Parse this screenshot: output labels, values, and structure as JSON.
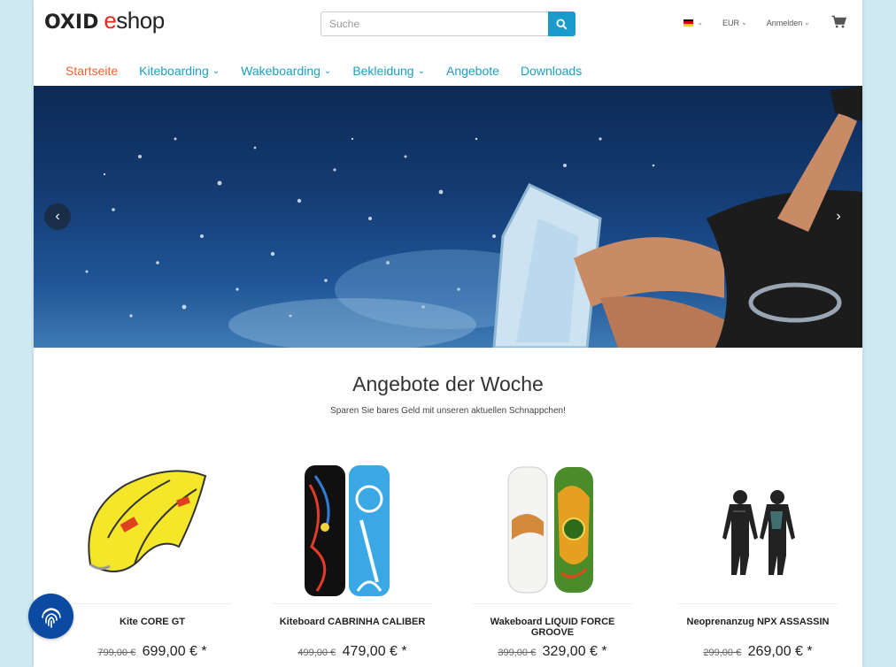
{
  "header": {
    "logo_text_1": "OXID",
    "logo_text_2": "shop",
    "logo_e": "e",
    "search_placeholder": "Suche",
    "language_flag": "de-flag",
    "currency": "EUR",
    "login": "Anmelden",
    "cart_icon": "cart-icon"
  },
  "nav": {
    "items": [
      {
        "label": "Startseite",
        "active": true
      },
      {
        "label": "Kiteboarding",
        "dropdown": true
      },
      {
        "label": "Wakeboarding",
        "dropdown": true
      },
      {
        "label": "Bekleidung",
        "dropdown": true
      },
      {
        "label": "Angebote"
      },
      {
        "label": "Downloads"
      }
    ]
  },
  "hero": {
    "prev_icon": "chevron-left-icon",
    "next_icon": "chevron-right-icon"
  },
  "section": {
    "title": "Angebote der Woche",
    "subtitle": "Sparen Sie bares Geld mit unseren aktuellen Schnappchen!"
  },
  "products": [
    {
      "name": "Kite CORE GT",
      "old_price": "799,00 €",
      "price": "699,00 € *"
    },
    {
      "name": "Kiteboard CABRINHA CALIBER",
      "old_price": "499,00 €",
      "price": "479,00 € *"
    },
    {
      "name": "Wakeboard LIQUID FORCE GROOVE",
      "old_price": "399,00 €",
      "price": "329,00 € *"
    },
    {
      "name": "Neoprenanzug NPX ASSASSIN",
      "old_price": "299,00 €",
      "price": "269,00 € *"
    }
  ],
  "colors": {
    "accent": "#1aa0c4",
    "active_nav": "#ef6430",
    "logo_red": "#e6261f",
    "search_button": "#1a9bc9",
    "background": "#cfe9f3"
  }
}
